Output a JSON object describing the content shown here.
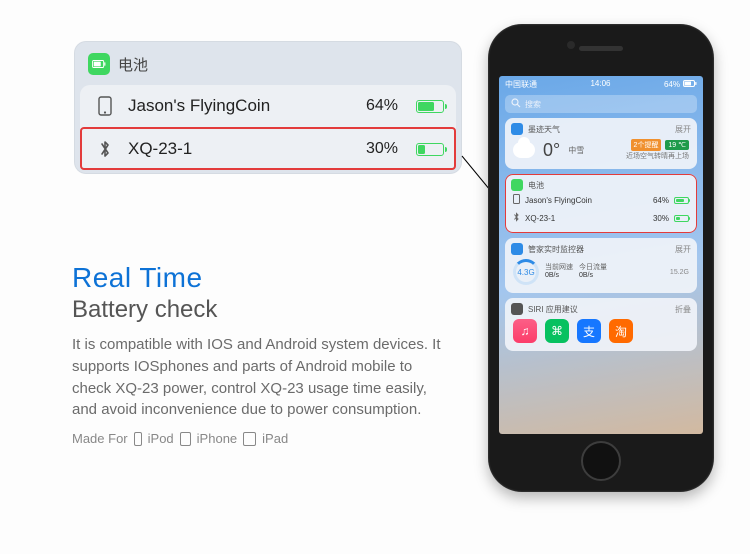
{
  "widget": {
    "title": "电池",
    "rows": [
      {
        "name": "Jason's FlyingCoin",
        "pct": "64%",
        "fill": 64,
        "icon": "phone"
      },
      {
        "name": "XQ-23-1",
        "pct": "30%",
        "fill": 30,
        "icon": "bluetooth",
        "highlight": true
      }
    ]
  },
  "copy": {
    "h1": "Real Time",
    "h2": "Battery check",
    "body": "It is compatible with IOS and Android system devices. It supports IOSphones and parts of Android mobile to check XQ-23 power, control XQ-23 usage time easily, and avoid inconvenience due to power consumption.",
    "made_label": "Made  For",
    "made_items": [
      "iPod",
      "iPhone",
      "iPad"
    ]
  },
  "phone": {
    "status": {
      "carrier": "中国联通",
      "time": "14:06",
      "battery": "64%"
    },
    "search_placeholder": "搜索",
    "weather": {
      "provider": "墨迹天气",
      "more": "展开",
      "temp": "0°",
      "cond": "中雪",
      "badge_hi": "2个提醒",
      "badge_lo": "19 ℃",
      "note": "近场空气转晴再上场"
    },
    "battery": {
      "title": "电池",
      "rows": [
        {
          "name": "Jason's FlyingCoin",
          "pct": "64%",
          "fill": 64
        },
        {
          "name": "XQ-23-1",
          "pct": "30%",
          "fill": 30
        }
      ]
    },
    "net": {
      "title": "管家实时监控器",
      "more": "展开",
      "ring": "4.3G",
      "up_label": "当前网速",
      "up": "0B/s",
      "dn_label": "今日流量",
      "dn": "0B/s",
      "total": "15.2G"
    },
    "siri": {
      "title": "SIRI 应用建议",
      "more": "折叠",
      "apps": [
        "♫",
        "⌘",
        "支",
        "淘"
      ]
    }
  }
}
